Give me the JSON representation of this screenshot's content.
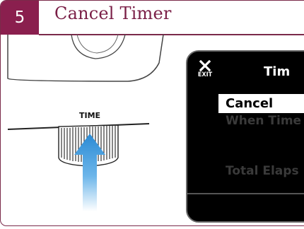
{
  "step": {
    "number": "5",
    "title": "Cancel Timer"
  },
  "device": {
    "knob_label": "TIME"
  },
  "display": {
    "exit_label": "EXIT",
    "title": "Tim",
    "menu": {
      "selected": "Cancel",
      "option_1": "When Time",
      "option_2": "Total Elaps"
    }
  },
  "colors": {
    "accent": "#8a1f4e",
    "arrow": "#2f8fd6",
    "screen_bg": "#000000"
  },
  "icons": {
    "exit": "close-icon",
    "press_indicator": "arrow-up-icon"
  }
}
